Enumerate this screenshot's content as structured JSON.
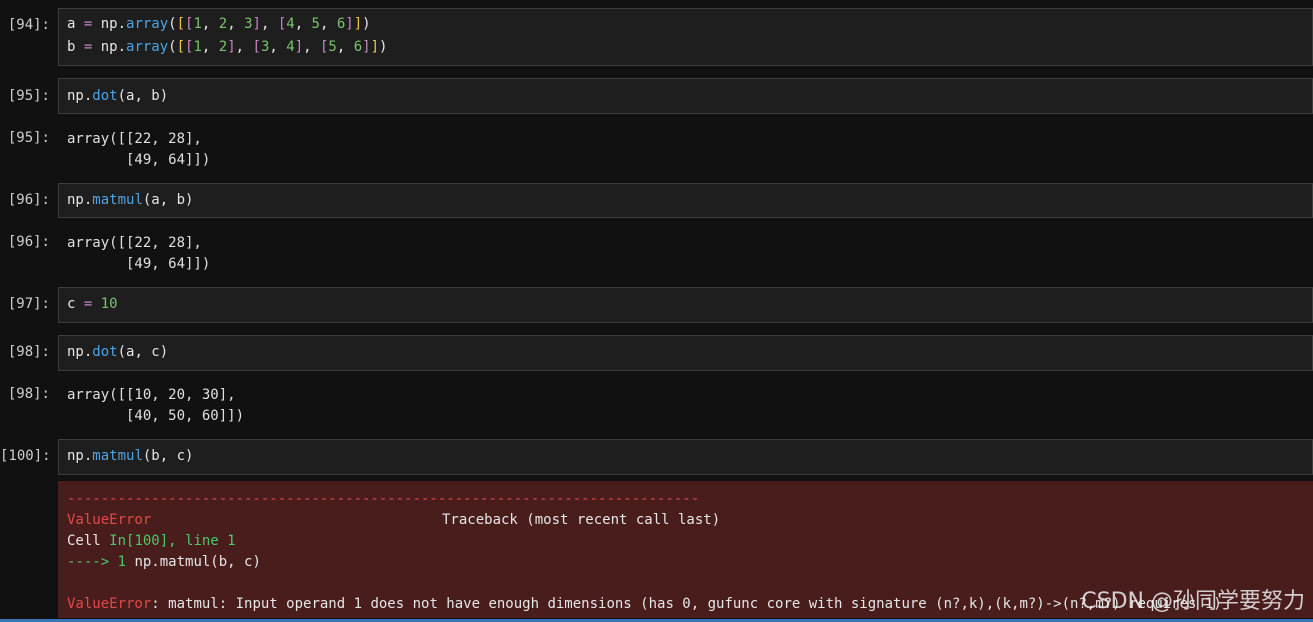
{
  "cells": [
    {
      "prompt": "[94]:",
      "lines": [
        "a = np.array([[1, 2, 3], [4, 5, 6]])",
        "b = np.array([[1, 2], [3, 4], [5, 6]])"
      ]
    },
    {
      "prompt": "[95]:",
      "lines": [
        "np.dot(a, b)"
      ],
      "out_prompt": "[95]:",
      "out": [
        "array([[22, 28],",
        "       [49, 64]])"
      ]
    },
    {
      "prompt": "[96]:",
      "lines": [
        "np.matmul(a, b)"
      ],
      "out_prompt": "[96]:",
      "out": [
        "array([[22, 28],",
        "       [49, 64]])"
      ]
    },
    {
      "prompt": "[97]:",
      "lines": [
        "c = 10"
      ]
    },
    {
      "prompt": "[98]:",
      "lines": [
        "np.dot(a, c)"
      ],
      "out_prompt": "[98]:",
      "out": [
        "array([[10, 20, 30],",
        "       [40, 50, 60]])"
      ]
    },
    {
      "prompt": "[100]:",
      "lines": [
        "np.matmul(b, c)"
      ]
    }
  ],
  "error": {
    "dashes": "---------------------------------------------------------------------------",
    "name": "ValueError",
    "traceback_label": "Traceback (most recent call last)",
    "cell_prefix": "Cell ",
    "cell_ref": "In[100], line 1",
    "arrow": "----> 1 ",
    "arrow_code": "np.matmul(b, c)",
    "final_name": "ValueError",
    "final_message": ": matmul: Input operand 1 does not have enough dimensions (has 0, gufunc core with signature (n?,k),(k,m?)->(n?,m?) requires 1)"
  },
  "watermark": "CSDN @孙同学要努力"
}
